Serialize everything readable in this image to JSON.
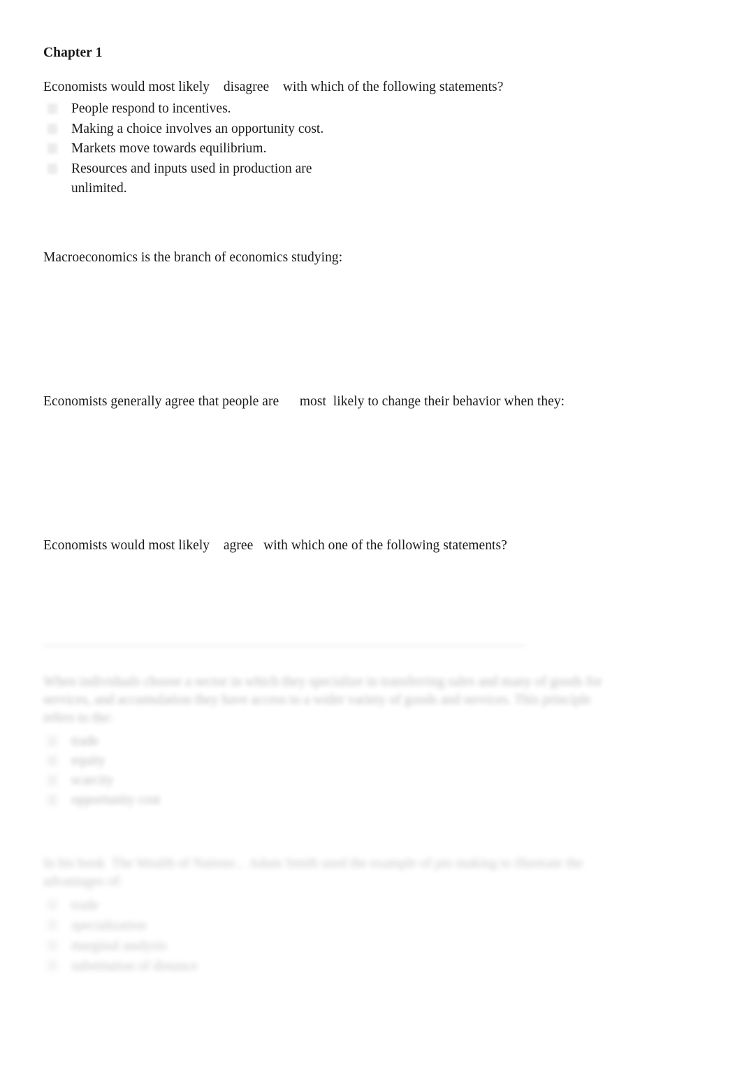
{
  "document": {
    "chapter_title": "Chapter 1"
  },
  "questions": [
    {
      "id": "q1",
      "prompt_before": "Economists would most likely",
      "emphasis": "disagree",
      "prompt_after": "with which of the following statements?",
      "options": [
        "People respond to incentives.",
        "Making a choice involves an opportunity cost.",
        "Markets move towards equilibrium.",
        "Resources and inputs used in production are unlimited."
      ]
    },
    {
      "id": "q2",
      "prompt_before": "Macroeconomics is the branch of economics studying:",
      "emphasis": "",
      "prompt_after": "",
      "options": []
    },
    {
      "id": "q3",
      "prompt_before": "Economists generally agree that people are",
      "emphasis": "most",
      "prompt_after": "likely to change their behavior when they:",
      "options": []
    },
    {
      "id": "q4",
      "prompt_before": "Economists would most likely",
      "emphasis": "agree",
      "prompt_after": "with which one of the following statements?",
      "options": []
    },
    {
      "id": "q5",
      "prompt_before": "When individuals choose a sector in which they specialize in transferring sales and many of goods for services, and accumulation they have access to a wider variety of goods and services. This principle refers to the:",
      "emphasis": "",
      "prompt_after": "",
      "options": [
        "trade",
        "equity",
        "scarcity",
        "opportunity cost"
      ]
    },
    {
      "id": "q6",
      "prompt_before": "In his book  The Wealth of Nations ,  Adam Smith used the example of pin making to illustrate the advantages of:",
      "emphasis": "",
      "prompt_after": "",
      "options": [
        "trade",
        "specialization",
        "marginal analysis",
        "substitution of distance"
      ]
    }
  ]
}
